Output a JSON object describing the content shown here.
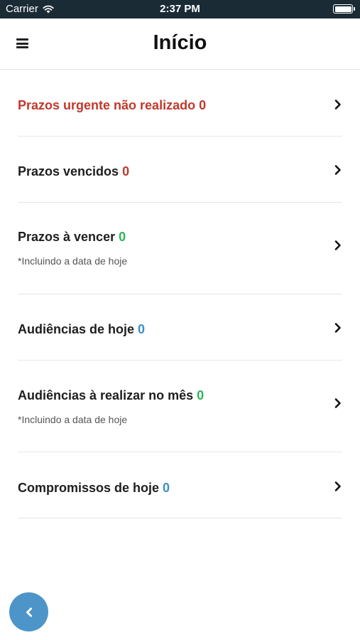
{
  "status_bar": {
    "carrier": "Carrier",
    "wifi_icon": "wifi-icon",
    "time": "2:37 PM",
    "battery_icon": "battery-icon"
  },
  "header": {
    "menu_icon": "hamburger-menu-icon",
    "title": "Início"
  },
  "colors": {
    "red": "#c0392b",
    "green": "#2eb35a",
    "blue": "#3a8fc7",
    "fab": "#4d95c9",
    "status_bar": "#1b2b36"
  },
  "items": [
    {
      "label": "Prazos urgente não realizado",
      "count": "0",
      "count_color": "red",
      "label_color": "red",
      "note": ""
    },
    {
      "label": "Prazos vencidos",
      "count": "0",
      "count_color": "red",
      "label_color": "default",
      "note": ""
    },
    {
      "label": "Prazos à vencer",
      "count": "0",
      "count_color": "green",
      "label_color": "default",
      "note": "*Incluindo a data de hoje"
    },
    {
      "label": "Audiências de hoje",
      "count": "0",
      "count_color": "blue",
      "label_color": "default",
      "note": ""
    },
    {
      "label": "Audiências à realizar no mês",
      "count": "0",
      "count_color": "green",
      "label_color": "default",
      "note": "*Incluindo a data de hoje"
    },
    {
      "label": "Compromissos de hoje",
      "count": "0",
      "count_color": "blue",
      "label_color": "default",
      "note": ""
    }
  ],
  "fab": {
    "icon": "chevron-left-icon"
  }
}
